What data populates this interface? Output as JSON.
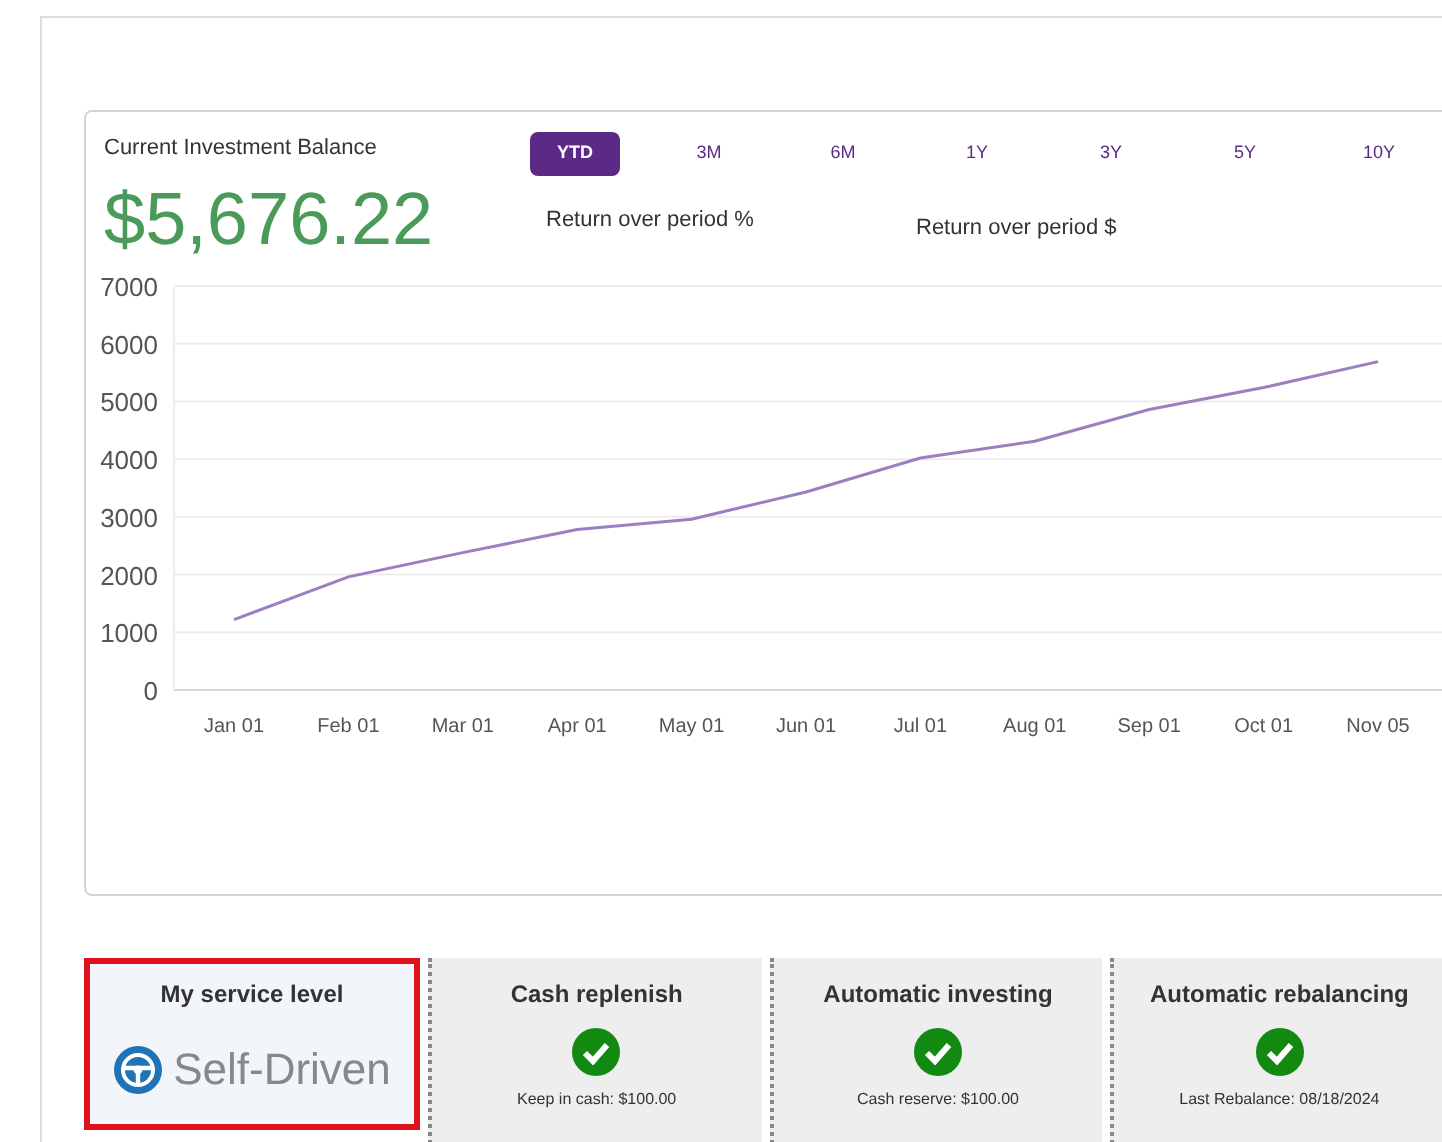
{
  "balance": {
    "label": "Current Investment Balance",
    "amount": "$5,676.22"
  },
  "periods": [
    {
      "label": "YTD",
      "selected": true
    },
    {
      "label": "3M",
      "selected": false
    },
    {
      "label": "6M",
      "selected": false
    },
    {
      "label": "1Y",
      "selected": false
    },
    {
      "label": "3Y",
      "selected": false
    },
    {
      "label": "5Y",
      "selected": false
    },
    {
      "label": "10Y",
      "selected": false
    }
  ],
  "returns": [
    {
      "label": "Return over period %"
    },
    {
      "label": "Return over period $"
    }
  ],
  "chart": {
    "chart_data": {
      "type": "line",
      "categories": [
        "Jan 01",
        "Feb 01",
        "Mar 01",
        "Apr 01",
        "May 01",
        "Jun 01",
        "Jul 01",
        "Aug 01",
        "Sep 01",
        "Oct 01",
        "Nov 05"
      ],
      "grid": true,
      "series": [
        {
          "color": "#9b7fc0",
          "values": [
            1220,
            1960,
            2380,
            2780,
            2960,
            3430,
            4020,
            4310,
            4860,
            5240,
            5690
          ]
        }
      ],
      "ylim": [
        0,
        7000
      ],
      "yticks": [
        0,
        1000,
        2000,
        3000,
        4000,
        5000,
        6000,
        7000
      ]
    }
  },
  "tiles": [
    {
      "kind": "service",
      "title": "My service level",
      "value": "Self-Driven",
      "highlighted": true
    },
    {
      "kind": "feature",
      "title": "Cash replenish",
      "enabled": true,
      "note": "Keep in cash: $100.00"
    },
    {
      "kind": "feature",
      "title": "Automatic investing",
      "enabled": true,
      "note": "Cash reserve: $100.00"
    },
    {
      "kind": "feature",
      "title": "Automatic rebalancing",
      "enabled": true,
      "note": "Last Rebalance: 08/18/2024"
    }
  ]
}
